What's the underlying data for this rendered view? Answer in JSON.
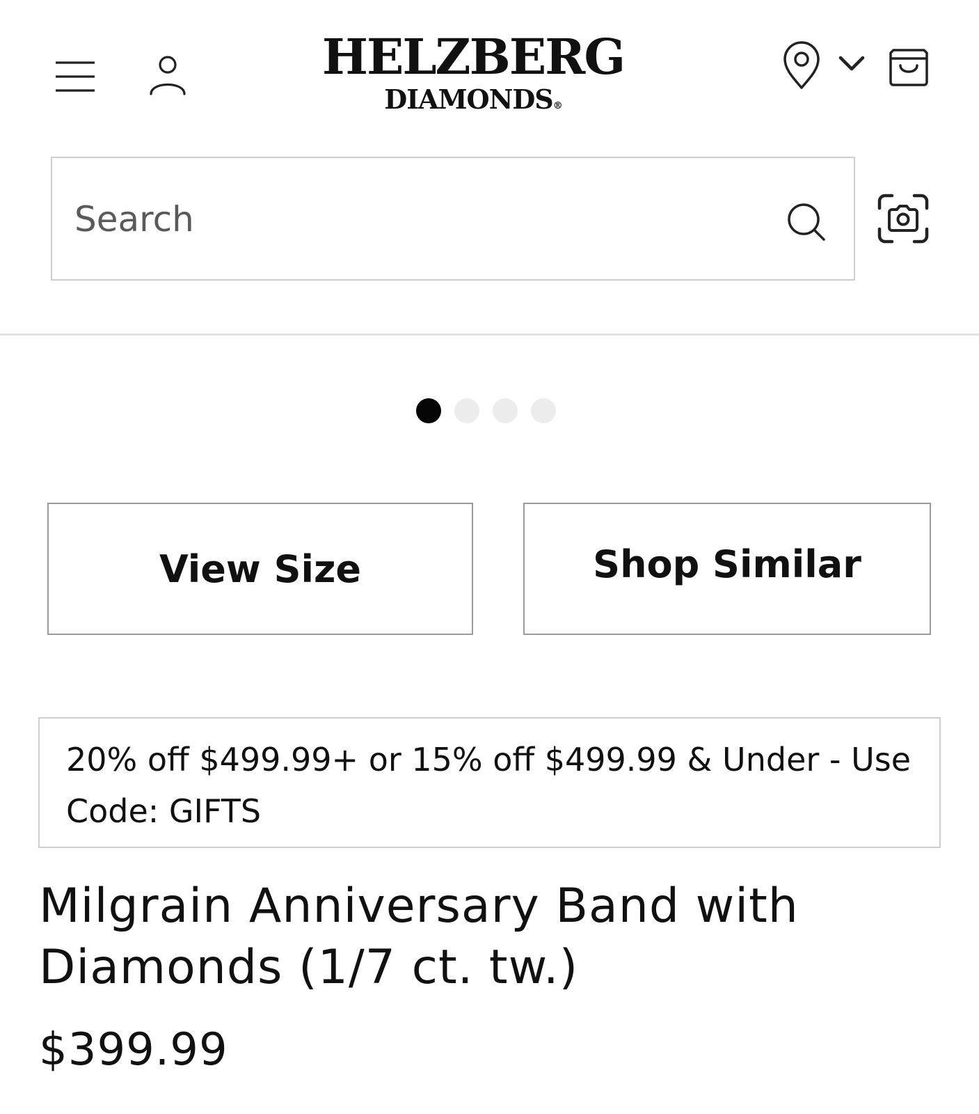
{
  "header": {
    "brand_line1": "HELZBERG",
    "brand_line2": "DIAMONDS",
    "brand_mark": "®",
    "icons": {
      "menu": "hamburger-menu-icon",
      "account": "user-icon",
      "location": "map-pin-icon",
      "chevron": "chevron-down-icon",
      "bag": "shopping-bag-icon"
    }
  },
  "search": {
    "placeholder": "Search",
    "value": "",
    "icons": {
      "search": "search-icon",
      "camera": "camera-icon"
    }
  },
  "carousel": {
    "slide_count": 4,
    "active_index": 0
  },
  "actions": {
    "view_size_label": "View Size",
    "shop_similar_label": "Shop Similar"
  },
  "promo": {
    "text": "20% off $499.99+ or 15% off $499.99 & Under - Use Code: GIFTS"
  },
  "product": {
    "title": "Milgrain Anniversary Band with Diamonds (1/7 ct. tw.)",
    "price": "$399.99"
  },
  "colors": {
    "text": "#111111",
    "border": "#cfcfcf",
    "button_border": "#9a9a9a",
    "dot_active": "#050505",
    "dot_inactive": "#ececec",
    "divider": "#e2e2e2"
  }
}
